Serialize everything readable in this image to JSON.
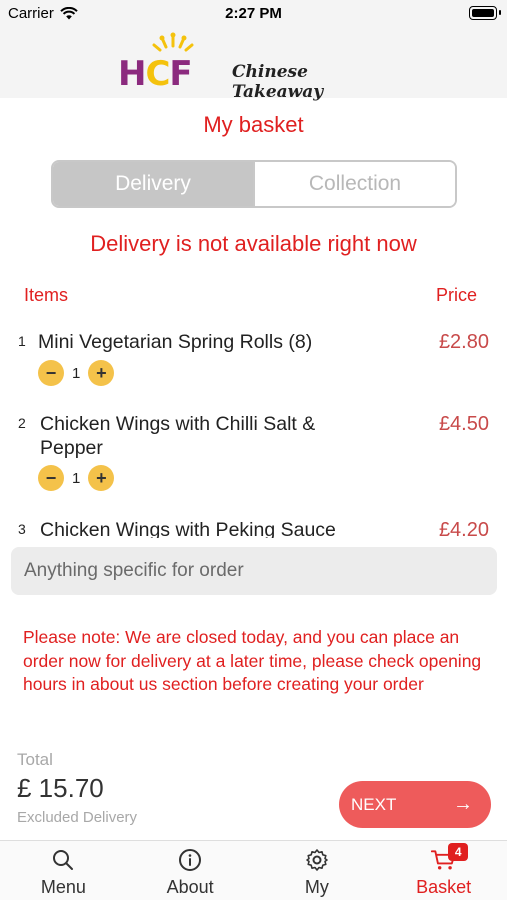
{
  "status_bar": {
    "carrier": "Carrier",
    "time": "2:27 PM"
  },
  "header": {
    "logo_letters": [
      "H",
      "C",
      "F"
    ],
    "logo_text": "Chinese Takeaway"
  },
  "page_title": "My basket",
  "segment": {
    "options": [
      "Delivery",
      "Collection"
    ],
    "selected": "Delivery"
  },
  "notice": "Delivery is not available right now",
  "columns": {
    "items": "Items",
    "price": "Price"
  },
  "items": [
    {
      "number": "1",
      "name": "Mini Vegetarian Spring Rolls (8)",
      "price": "£2.80",
      "quantity": "1"
    },
    {
      "number": "2",
      "name": "Chicken Wings with Chilli Salt & Pepper",
      "price": "£4.50",
      "quantity": "1"
    },
    {
      "number": "3",
      "name": "Chicken Wings with Peking Sauce",
      "price": "£4.20",
      "quantity": ""
    }
  ],
  "qty_controls": {
    "minus": "−",
    "plus": "+"
  },
  "note_input": {
    "placeholder": "Anything specific for order",
    "value": ""
  },
  "please_note": "Please note: We are closed today, and you can place an order now for delivery at a later time, please check opening hours in about us section before creating your order",
  "total": {
    "label": "Total",
    "value": "£ 15.70",
    "sub": "Excluded Delivery"
  },
  "next_button": {
    "label": "NEXT",
    "arrow": "→"
  },
  "tabbar": {
    "tabs": [
      {
        "label": "Menu",
        "icon": "search-icon"
      },
      {
        "label": "About",
        "icon": "info-icon"
      },
      {
        "label": "My",
        "icon": "gear-icon"
      },
      {
        "label": "Basket",
        "icon": "cart-icon",
        "badge": "4",
        "active": true
      }
    ]
  },
  "colors": {
    "accent_red": "#e02020",
    "price_red": "#c84a4a",
    "next_button": "#ee5b5b",
    "qty_yellow": "#f4c24a",
    "logo_purple": "#8b2a7e",
    "logo_yellow": "#f4c20d"
  }
}
